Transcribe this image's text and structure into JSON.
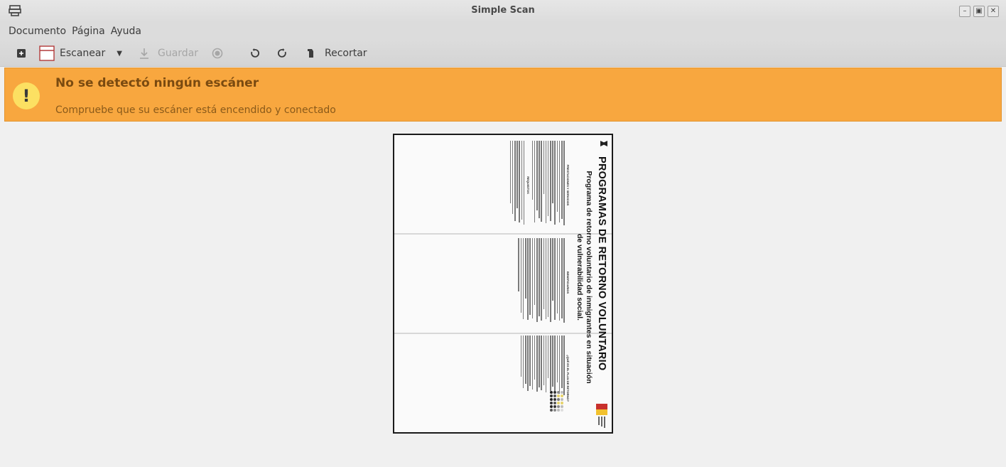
{
  "window": {
    "title": "Simple Scan",
    "icon": "scanner-icon",
    "controls": [
      "minimize-icon",
      "maximize-icon",
      "close-icon"
    ]
  },
  "menu": {
    "items": [
      "Documento",
      "Página",
      "Ayuda"
    ]
  },
  "toolbar": {
    "new_icon": "new-document-icon",
    "scan_label": "Escanear",
    "save_label": "Guardar",
    "crop_label": "Recortar"
  },
  "banner": {
    "title": "No se detectó ningún escáner",
    "message": "Compruebe que su escáner está encendido y conectado",
    "color": "#f8a73f",
    "icon": "warning-icon"
  },
  "document": {
    "title": "PROGRAMAS DE RETORNO VOLUNTARIO",
    "subtitle": "Programa de retorno voluntario de inmigrantes en situación de vulnerabilidad social.",
    "col_heads": [
      "¿QUÉ ES EL PLAN DE RETORNO?",
      "BENEFICIARIOS",
      "PRESTACIONES Y SERVICIOS",
      "REQUISITOS"
    ]
  }
}
